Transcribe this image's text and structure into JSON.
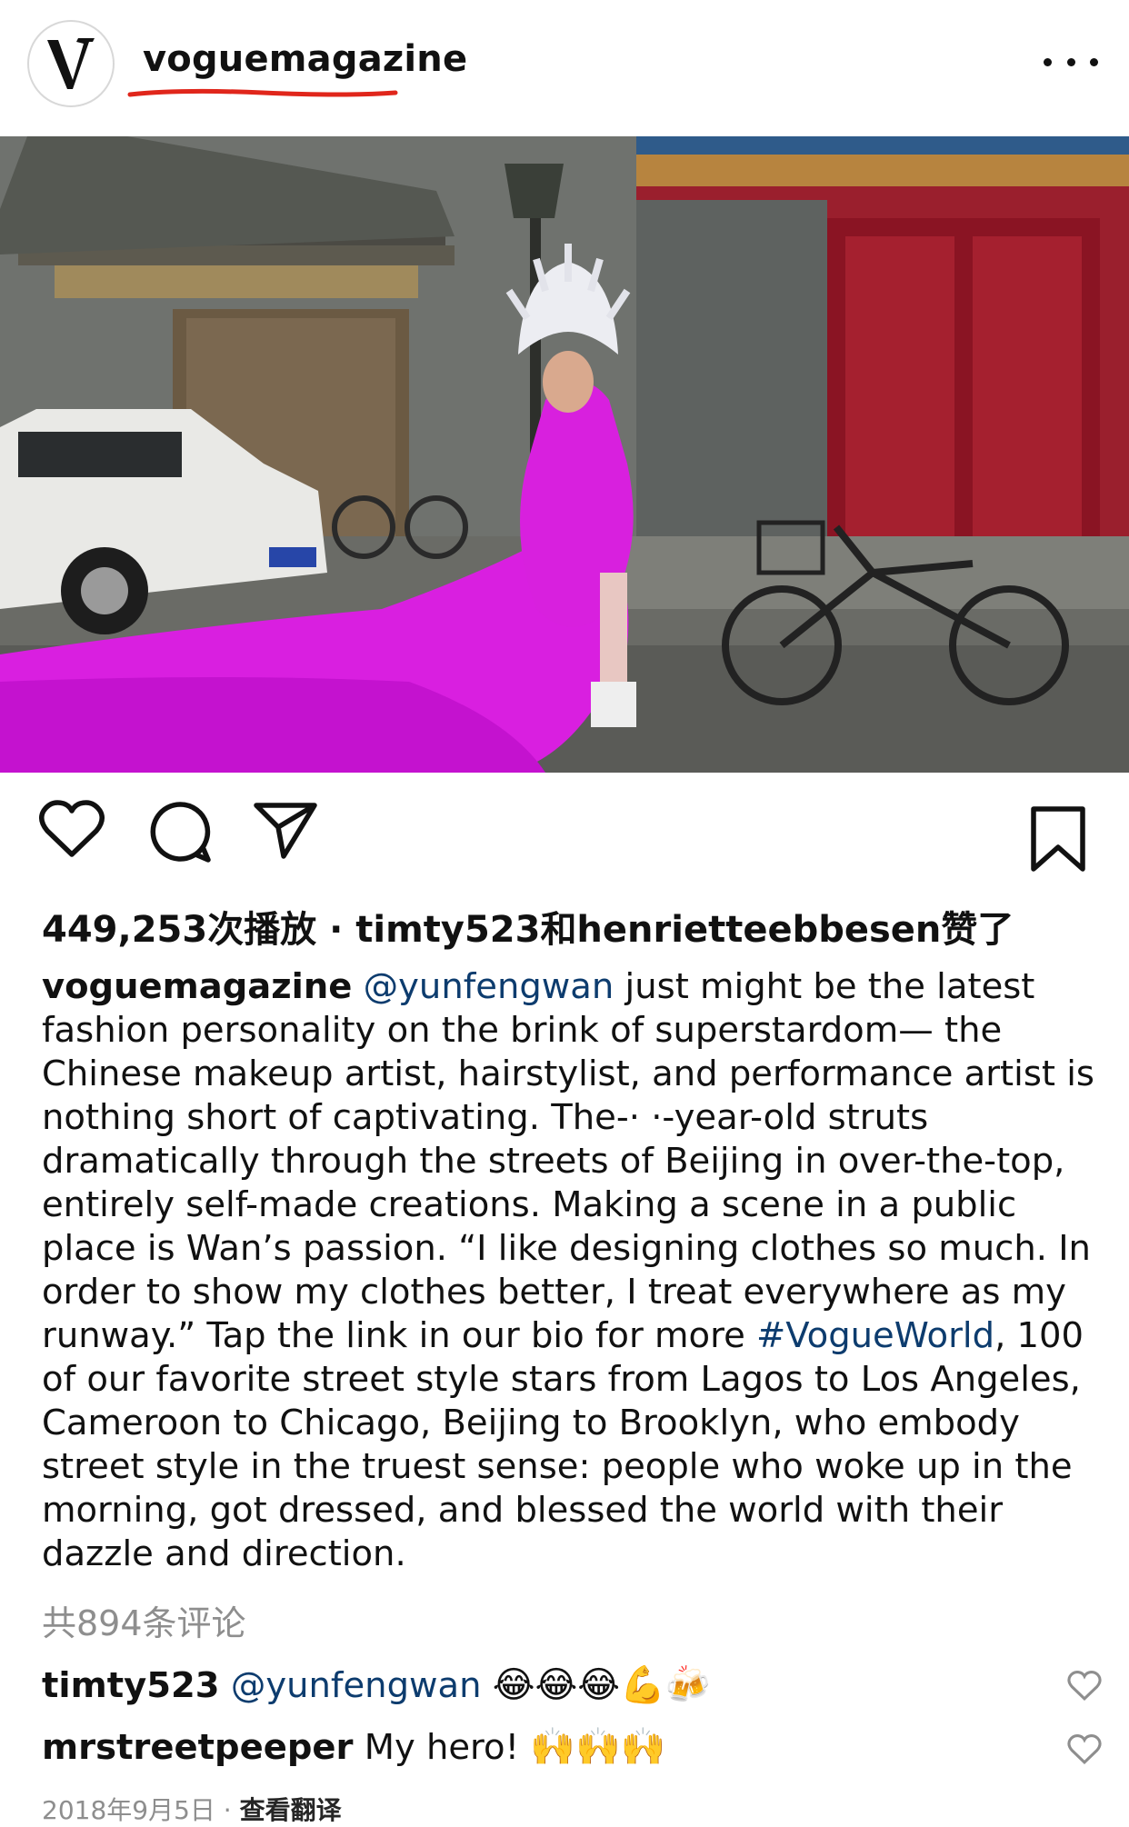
{
  "post": {
    "username": "voguemagazine",
    "avatar_letter": "V",
    "underline_color": "#e0261b"
  },
  "media": {
    "type": "video",
    "dominant_dress_color": "#d91fe0"
  },
  "actions": {
    "like_icon": "heart-icon",
    "comment_icon": "comment-icon",
    "share_icon": "send-icon",
    "save_icon": "bookmark-icon"
  },
  "stats": {
    "views": "449,253次播放",
    "separator": " · ",
    "liked_by": "timty523和henrietteebbesen赞了"
  },
  "caption": {
    "username": "voguemagazine",
    "mention": "@yunfengwan",
    "text_1": " just might be the latest fashion personality on the brink of superstardom— the Chinese makeup artist, hairstylist, and performance artist is nothing short of captivating. The-· ·-year-old struts dramatically through the streets of Beijing in over-the-top, entirely self-made creations. Making a scene in a public place is Wan’s passion. “I like designing clothes so much. In order to show my clothes better, I treat everywhere as my runway.” Tap the link in our bio for more ",
    "hashtag": "#VogueWorld",
    "text_2": ", 100 of our favorite street style stars from Lagos to Los Angeles, Cameroon to Chicago, Beijing to Brooklyn, who embody street style in the truest sense: people who woke up in the morning, got dressed, and blessed the world with their dazzle and direction."
  },
  "comments_count": "共894条评论",
  "comments": [
    {
      "username": "timty523",
      "mention": "@yunfengwan",
      "text": "",
      "emojis": "😂😂😂💪🍻"
    },
    {
      "username": "mrstreetpeeper",
      "mention": "",
      "text": "My hero!",
      "emojis": "🙌🙌🙌"
    }
  ],
  "footer": {
    "date": "2018年9月5日",
    "separator": " · ",
    "translate": "查看翻译"
  }
}
